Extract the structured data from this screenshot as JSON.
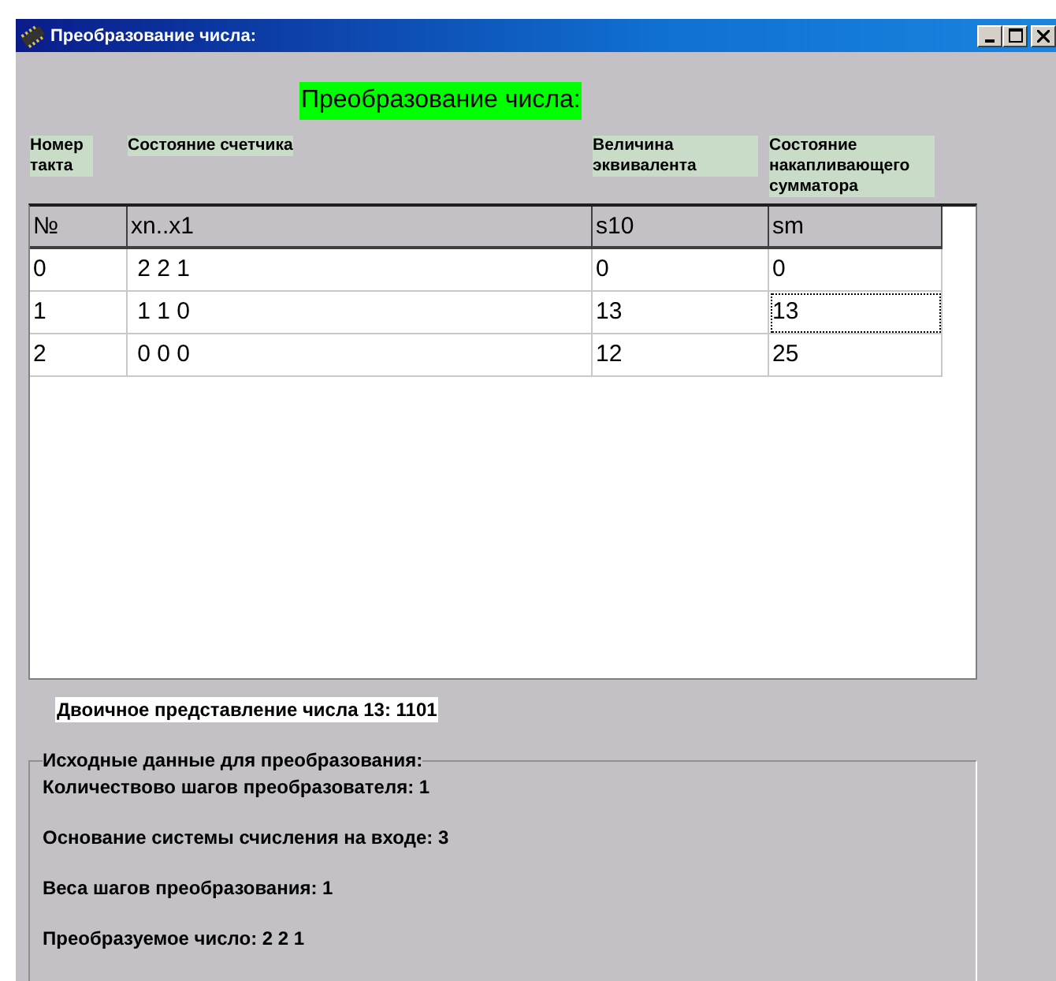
{
  "window": {
    "title": "Преобразование числа:"
  },
  "heading": "Преобразование числа:",
  "column_labels": [
    "Номер такта",
    "Состояние счетчика",
    "Величина эквивалента",
    "Состояние накапливающего сумматора"
  ],
  "table": {
    "columns": [
      "№",
      "xn..x1",
      "s10",
      "sm"
    ],
    "rows": [
      {
        "cells": [
          "0",
          " 2 2 1",
          "0",
          "0"
        ],
        "focused": false
      },
      {
        "cells": [
          "1",
          " 1 1 0",
          "13",
          "13"
        ],
        "focused": true
      },
      {
        "cells": [
          "2",
          " 0 0 0",
          "12",
          "25"
        ],
        "focused": false
      }
    ]
  },
  "binary_result": "Двоичное представление числа 13: 1101",
  "source_group": {
    "title": "Исходные данные для преобразования:",
    "lines": [
      "Количествово шагов преобразователя: 1",
      "Основание системы счисления на входе: 3",
      "Веса шагов преобразования: 1",
      "Преобразуемое число: 2 2 1"
    ]
  }
}
